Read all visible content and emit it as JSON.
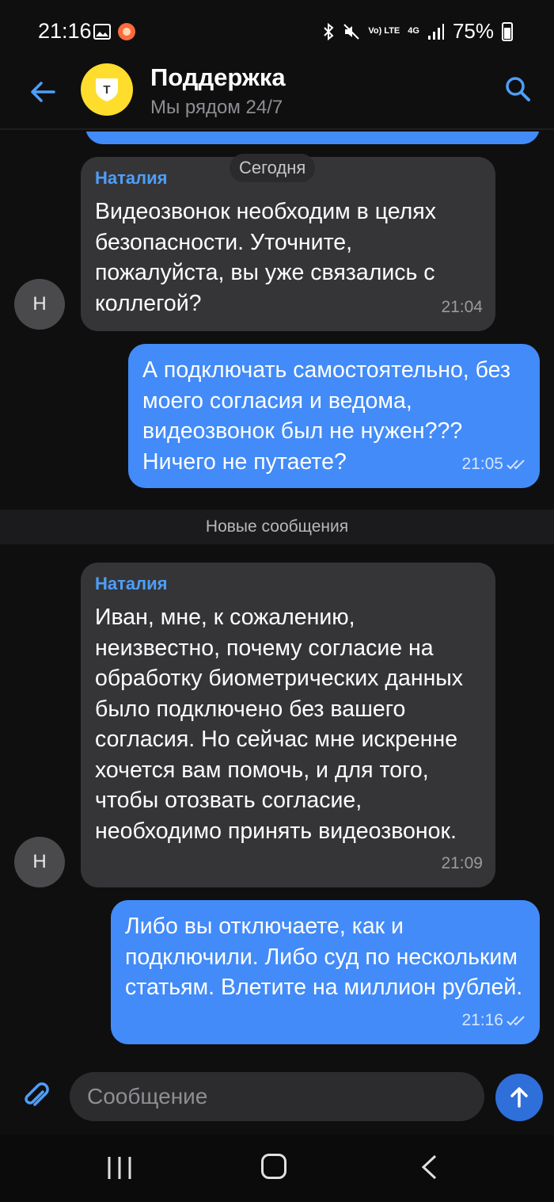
{
  "status_bar": {
    "time": "21:16",
    "battery": "75%",
    "network": "4G",
    "volte": "Vo) LTE"
  },
  "header": {
    "title": "Поддержка",
    "subtitle": "Мы рядом 24/7",
    "logo_letter": "T"
  },
  "date_separator": "Сегодня",
  "new_messages_label": "Новые сообщения",
  "messages": [
    {
      "sender": "Наталия",
      "avatar_initial": "Н",
      "text": "Видеозвонок необходим в целях безопасности. Уточните, пожалуйста, вы уже связались с коллегой?",
      "time": "21:04"
    },
    {
      "text": "А подключать самостоятельно, без моего согласия и ведома, видеозвонок был не нужен??? Ничего не путаете?",
      "time": "21:05"
    },
    {
      "sender": "Наталия",
      "avatar_initial": "Н",
      "text": "Иван, мне, к сожалению, неизвестно, почему согласие на обработку биометрических данных было подключено без вашего согласия. Но сейчас мне искренне хочется вам помочь, и для того, чтобы отозвать согласие, необходимо принять видеозвонок.",
      "time": "21:09"
    },
    {
      "text": "Либо вы отключаете, как и подключили. Либо суд по нескольким статьям. Влетите на миллион рублей.",
      "time": "21:16"
    }
  ],
  "composer": {
    "placeholder": "Сообщение"
  },
  "colors": {
    "accent": "#428bf9",
    "incoming": "#353537",
    "logo": "#ffdd2d",
    "background": "#0f0f10"
  }
}
